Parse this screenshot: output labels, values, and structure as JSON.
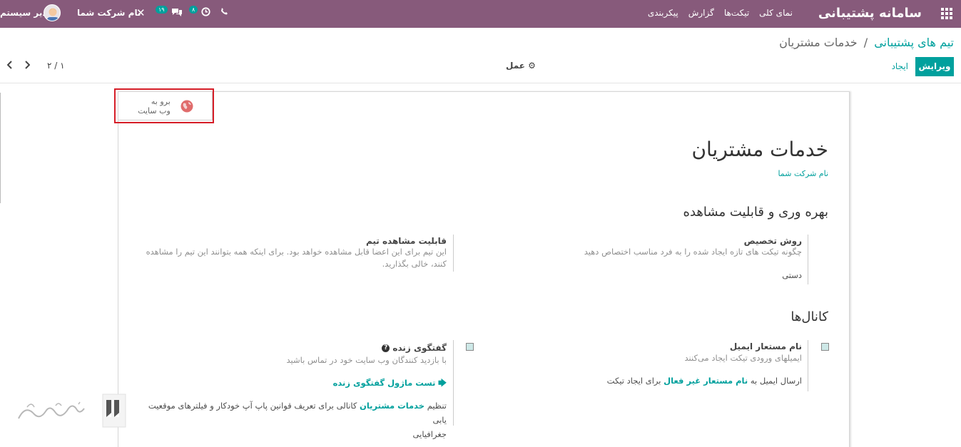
{
  "navbar": {
    "brand": "سامانه پشتیبانی",
    "menu": [
      "نمای کلی",
      "تیکت‌ها",
      "گزارش",
      "پیکربندی"
    ],
    "user_name": "مدیر سیستم",
    "company": "نام شرکت شما",
    "messages_count": "۱۹",
    "activities_count": "۸"
  },
  "control_panel": {
    "breadcrumb_parent": "تیم های پشتیبانی",
    "breadcrumb_sep": "/",
    "breadcrumb_current": "خدمات مشتریان",
    "edit_label": "ویرایش",
    "create_label": "ایجاد",
    "action_label": "عمل",
    "pager": "۲ / ۱"
  },
  "button_box": {
    "website_line1": "برو به",
    "website_line2": "وب سایت"
  },
  "form": {
    "title": "خدمات مشتریان",
    "company": "نام شرکت شما",
    "section_productivity": "بهره وری و قابلیت مشاهده",
    "assignment_title": "روش تخصیص",
    "assignment_help": "چگونه تیکت های تازه ایجاد شده را به فرد مناسب اختصاص دهید",
    "assignment_value": "دستی",
    "visibility_title": "قابلیت مشاهده تیم",
    "visibility_help_1": "این تیم برای این اعضا قابل مشاهده خواهد بود. برای اینکه همه بتوانند این تیم را مشاهده",
    "visibility_help_2": "کنند، خالی بگذارید.",
    "section_channels": "کانال‌ها",
    "alias_title": "نام مستعار ایمیل",
    "alias_help": "ایمیلهای ورودی تیکت ایجاد می‌کنند",
    "alias_line_pre": "ارسال ایمیل به",
    "alias_line_link": "نام مستعار غیر فعال",
    "alias_line_post": "برای ایجاد تیکت",
    "livechat_title": "گفتگوی زنده",
    "livechat_help": "با بازدید کنندگان وب سایت خود در تماس باشید",
    "livechat_test": "تست ماژول گفتگوی زنده",
    "livechat_config_pre": "تنظیم",
    "livechat_config_link": "خدمات مشتریان",
    "livechat_config_post": "کانالی برای تعریف قوانین پاپ آپ خودکار و فیلترهای موقعیت یابی",
    "livechat_config_line2": "جغرافیایی"
  },
  "colors": {
    "navbar": "#875a7b",
    "accent": "#00a09d",
    "highlight": "#d61e28"
  }
}
